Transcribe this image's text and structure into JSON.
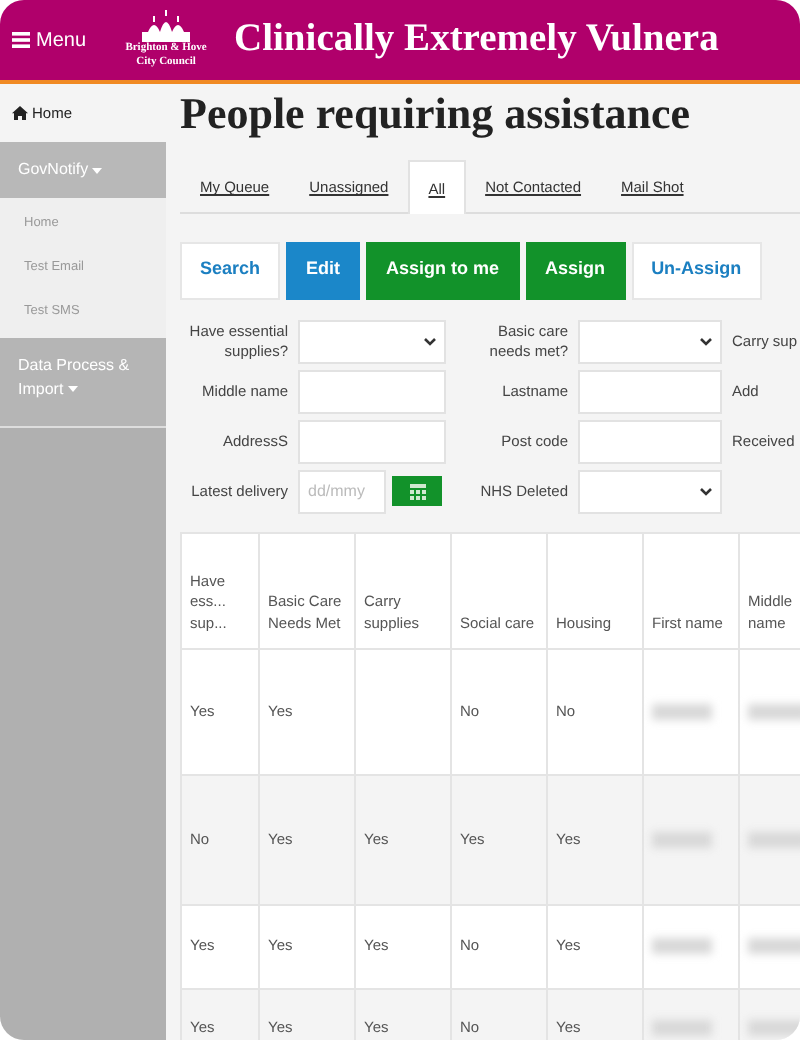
{
  "header": {
    "menu_label": "Menu",
    "council_name": "Brighton & Hove City Council",
    "title": "Clinically Extremely Vulnera"
  },
  "sidebar": {
    "items": [
      {
        "label": "Home",
        "kind": "home",
        "selected": true
      },
      {
        "label": "GovNotify",
        "kind": "group",
        "expanded": true,
        "children": [
          {
            "label": "Home"
          },
          {
            "label": "Test Email"
          },
          {
            "label": "Test SMS"
          }
        ]
      },
      {
        "label": "Data Process & Import",
        "kind": "group",
        "expanded": false
      }
    ]
  },
  "page_title": "People requiring assistance",
  "tabs": [
    {
      "label": "My Queue",
      "selected": false
    },
    {
      "label": "Unassigned",
      "selected": false
    },
    {
      "label": "All",
      "selected": true
    },
    {
      "label": "Not Contacted",
      "selected": false
    },
    {
      "label": "Mail Shot",
      "selected": false
    }
  ],
  "buttons": [
    {
      "label": "Search",
      "kind": "outline"
    },
    {
      "label": "Edit",
      "kind": "blue"
    },
    {
      "label": "Assign to me",
      "kind": "green"
    },
    {
      "label": "Assign",
      "kind": "green"
    },
    {
      "label": "Un-Assign",
      "kind": "outline"
    }
  ],
  "filters": [
    [
      {
        "label": "Have essential supplies?",
        "kind": "select"
      },
      {
        "label": "Basic care needs met?",
        "kind": "select"
      },
      {
        "label": "Carry sup",
        "kind": "label"
      }
    ],
    [
      {
        "label": "Middle name",
        "kind": "text"
      },
      {
        "label": "Lastname",
        "kind": "text"
      },
      {
        "label": "Add",
        "kind": "label"
      }
    ],
    [
      {
        "label": "AddressS",
        "kind": "text"
      },
      {
        "label": "Post code",
        "kind": "text"
      },
      {
        "label": "Received",
        "kind": "label"
      }
    ],
    [
      {
        "label": "Latest delivery",
        "kind": "date",
        "placeholder": "dd/mmy"
      },
      {
        "label": "NHS Deleted",
        "kind": "select"
      }
    ]
  ],
  "table": {
    "columns": [
      "Have ess... sup...",
      "Basic Care Needs Met",
      "Carry supplies",
      "Social care",
      "Housing",
      "First name",
      "Middle name"
    ],
    "rows": [
      {
        "cells": [
          "Yes",
          "Yes",
          null,
          "No",
          "No"
        ]
      },
      {
        "cells": [
          "No",
          "Yes",
          "Yes",
          "Yes",
          "Yes"
        ]
      },
      {
        "cells": [
          "Yes",
          "Yes",
          "Yes",
          "No",
          "Yes"
        ]
      },
      {
        "cells": [
          "Yes",
          "Yes",
          "Yes",
          "No",
          "Yes"
        ]
      }
    ]
  }
}
